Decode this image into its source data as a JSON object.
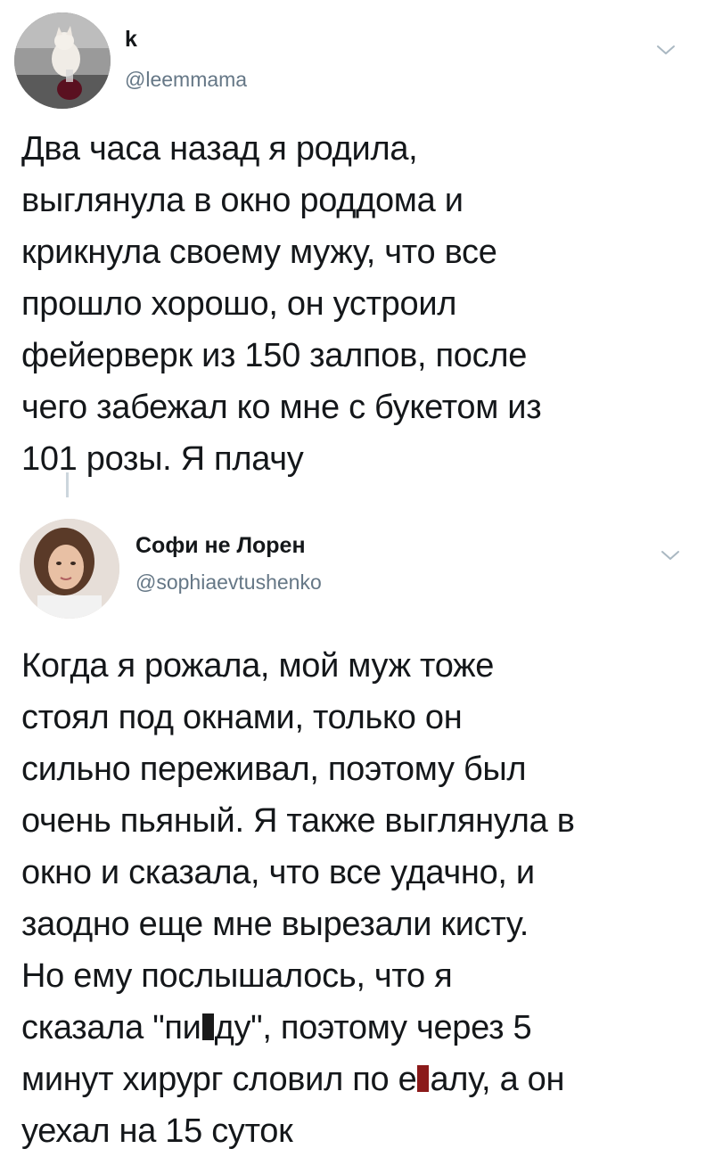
{
  "tweets": [
    {
      "name": "k",
      "handle": "@leemmama",
      "avatar_icon": "cat-avatar-icon",
      "menu_icon": "chevron-down-icon",
      "lines": [
        "Два часа назад я родила,",
        "выглянула в окно роддома и",
        "крикнула своему мужу, что все",
        "прошло хорошо, он устроил",
        "фейерверк из 150 залпов, после",
        "чего забежал ко мне с букетом из",
        "101 розы. Я плачу"
      ]
    },
    {
      "name": "Софи не Лорен",
      "handle": "@sophiaevtushenko",
      "avatar_icon": "person-avatar-icon",
      "menu_icon": "chevron-down-icon",
      "lines": [
        "Когда я рожала, мой муж тоже",
        "стоял под окнами, только он",
        "сильно переживал, поэтому был",
        "очень пьяный. Я также выглянула в",
        "окно и сказала, что все удачно, и",
        "заодно еще мне вырезали кисту.",
        "Но ему послышалось, что я"
      ],
      "line8": {
        "before": "сказала \"пи",
        "after": "ду\", поэтому через 5"
      },
      "line9": {
        "before": "минут хирург словил по е",
        "after": "алу, а он"
      },
      "lines_end": [
        "уехал на 15 суток"
      ],
      "censor_colors": {
        "first": "#1a1a1a",
        "second": "#8b1a1a"
      }
    }
  ],
  "colors": {
    "text": "#14171a",
    "secondary": "#657786",
    "thread_line": "#ccd6dd",
    "chevron": "#aab8c2"
  }
}
